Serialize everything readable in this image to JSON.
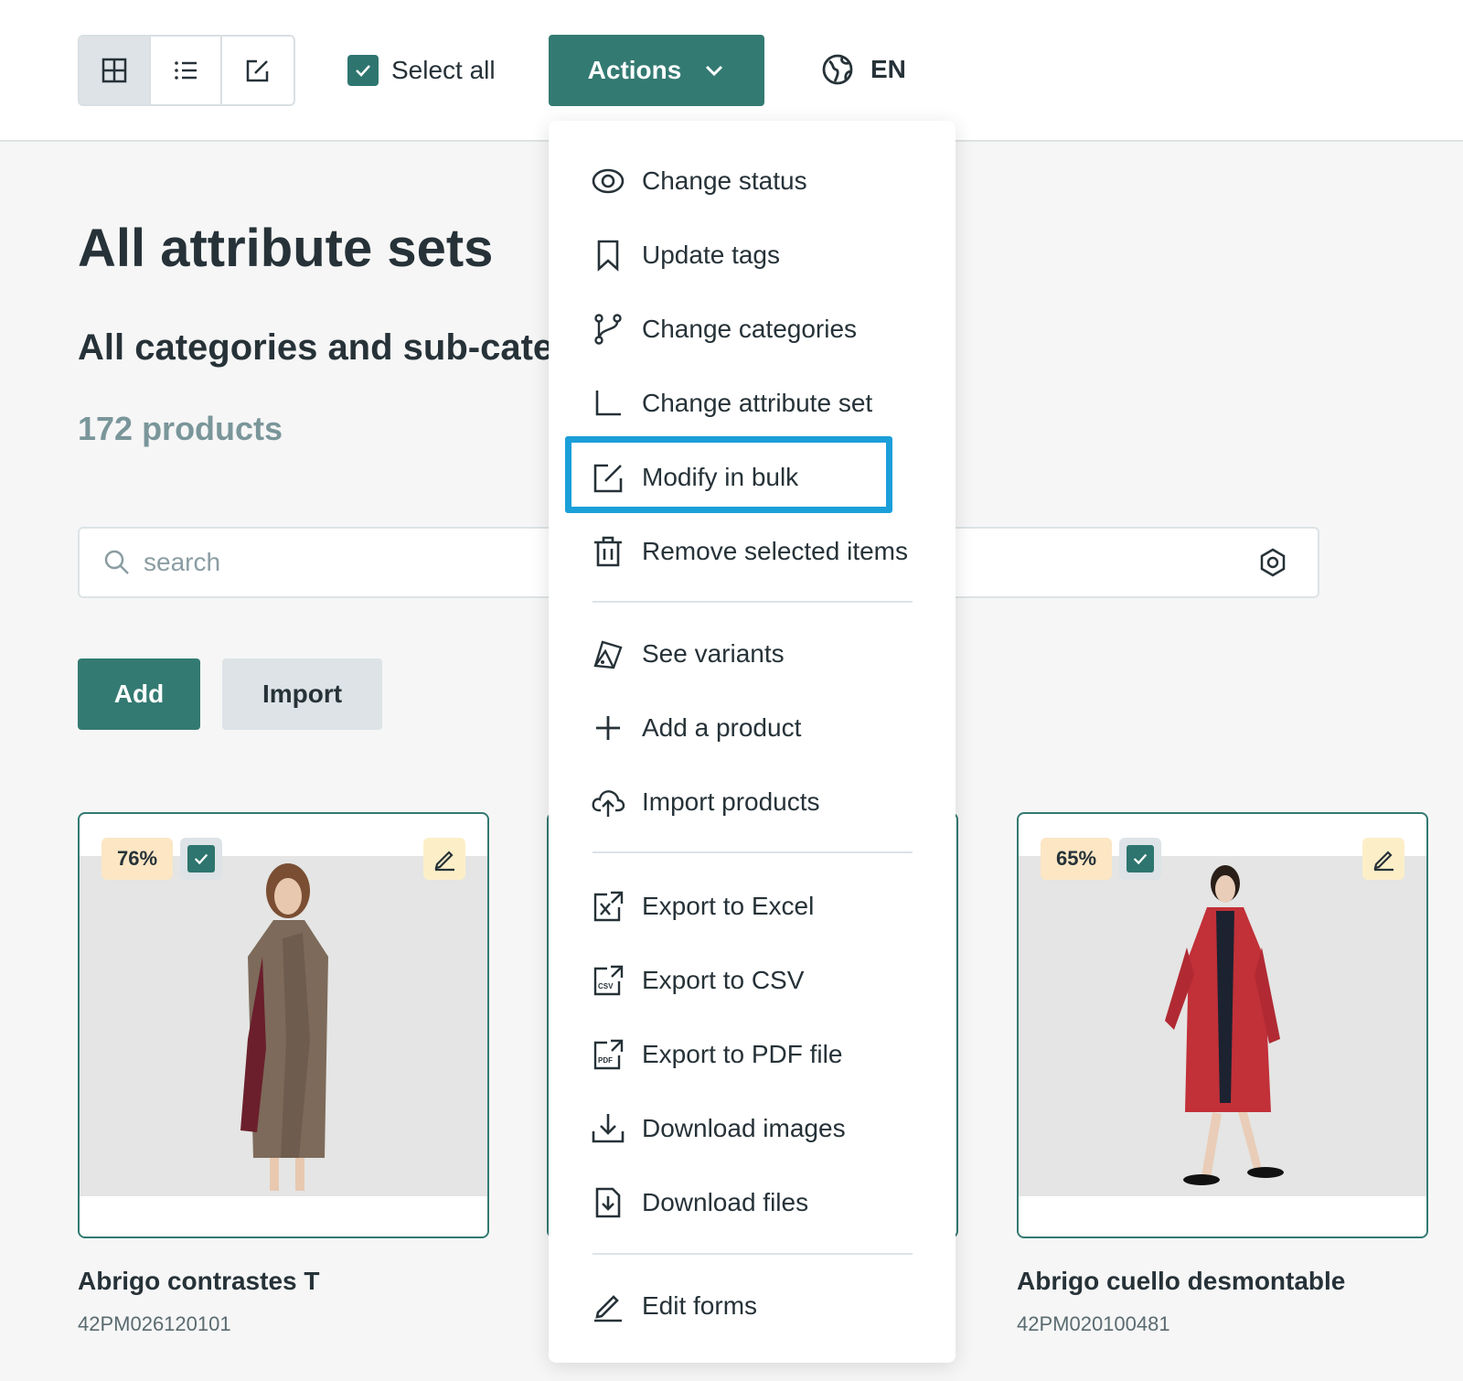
{
  "toolbar": {
    "select_all_label": "Select all",
    "actions_label": "Actions",
    "language": "EN"
  },
  "header": {
    "title": "All attribute sets",
    "subtitle": "All categories and sub-categories",
    "product_count": "172 products"
  },
  "search": {
    "placeholder": "search"
  },
  "buttons": {
    "add": "Add",
    "import": "Import"
  },
  "actions_menu": {
    "items": [
      {
        "label": "Change status",
        "icon": "eye-icon"
      },
      {
        "label": "Update tags",
        "icon": "bookmark-icon"
      },
      {
        "label": "Change categories",
        "icon": "branch-icon"
      },
      {
        "label": "Change attribute set",
        "icon": "corner-icon"
      },
      {
        "label": "Modify in bulk",
        "icon": "edit-square-icon",
        "highlighted": true
      },
      {
        "label": "Remove selected items",
        "icon": "trash-icon"
      },
      {
        "label": "See variants",
        "icon": "swatches-icon"
      },
      {
        "label": "Add a product",
        "icon": "plus-icon"
      },
      {
        "label": "Import products",
        "icon": "cloud-upload-icon"
      },
      {
        "label": "Export to Excel",
        "icon": "excel-export-icon"
      },
      {
        "label": "Export to CSV",
        "icon": "csv-export-icon"
      },
      {
        "label": "Export to PDF file",
        "icon": "pdf-export-icon"
      },
      {
        "label": "Download images",
        "icon": "download-tray-icon"
      },
      {
        "label": "Download files",
        "icon": "download-file-icon"
      },
      {
        "label": "Edit forms",
        "icon": "pencil-line-icon"
      }
    ],
    "icon_labels": {
      "csv": "CSV",
      "pdf": "PDF"
    }
  },
  "products": [
    {
      "completeness": "76%",
      "name": "Abrigo contrastes T",
      "sku": "42PM026120101"
    },
    {
      "completeness": "65%",
      "name": "Abrigo cuello desmontable",
      "sku": "42PM020100481"
    }
  ],
  "colors": {
    "primary": "#337a72",
    "highlight": "#1a9fd9",
    "completeness_bg": "#fce6c4"
  }
}
